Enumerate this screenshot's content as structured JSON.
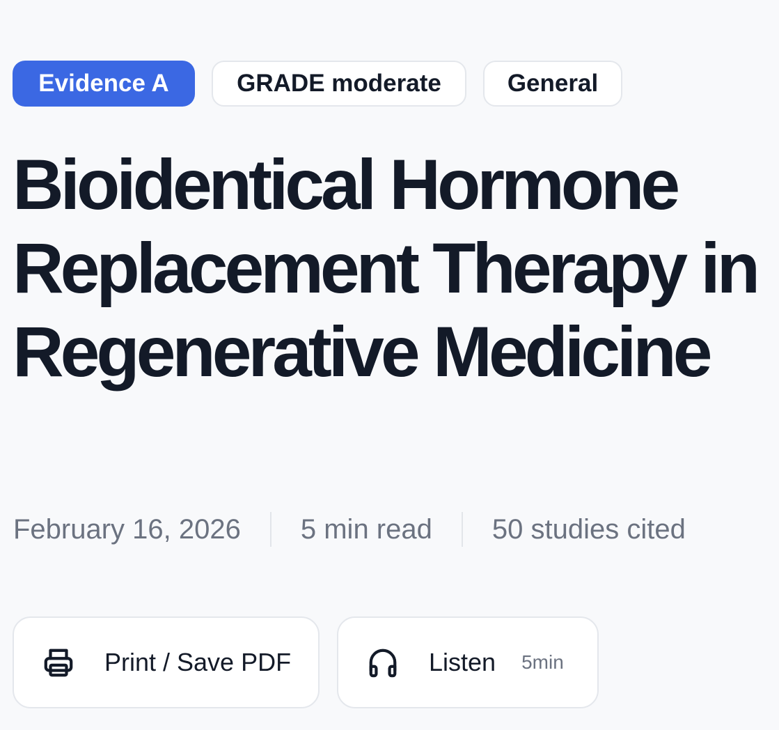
{
  "tags": [
    {
      "label": "Evidence A",
      "style": "primary"
    },
    {
      "label": "GRADE moderate",
      "style": "outline"
    },
    {
      "label": "General",
      "style": "outline"
    }
  ],
  "article": {
    "title": "Bioidentical Hormone Replacement Therapy in Regenerative Medicine"
  },
  "meta": {
    "date": "February 16, 2026",
    "read_time": "5 min read",
    "studies": "50 studies cited"
  },
  "actions": {
    "print": {
      "label": "Print / Save PDF",
      "icon": "printer-icon"
    },
    "listen": {
      "label": "Listen",
      "duration": "5min",
      "icon": "headphones-icon"
    }
  },
  "colors": {
    "accent": "#3b68e3",
    "text": "#131a28",
    "muted": "#6b7280",
    "background": "#f8f9fb",
    "border": "#e4e7ec"
  }
}
